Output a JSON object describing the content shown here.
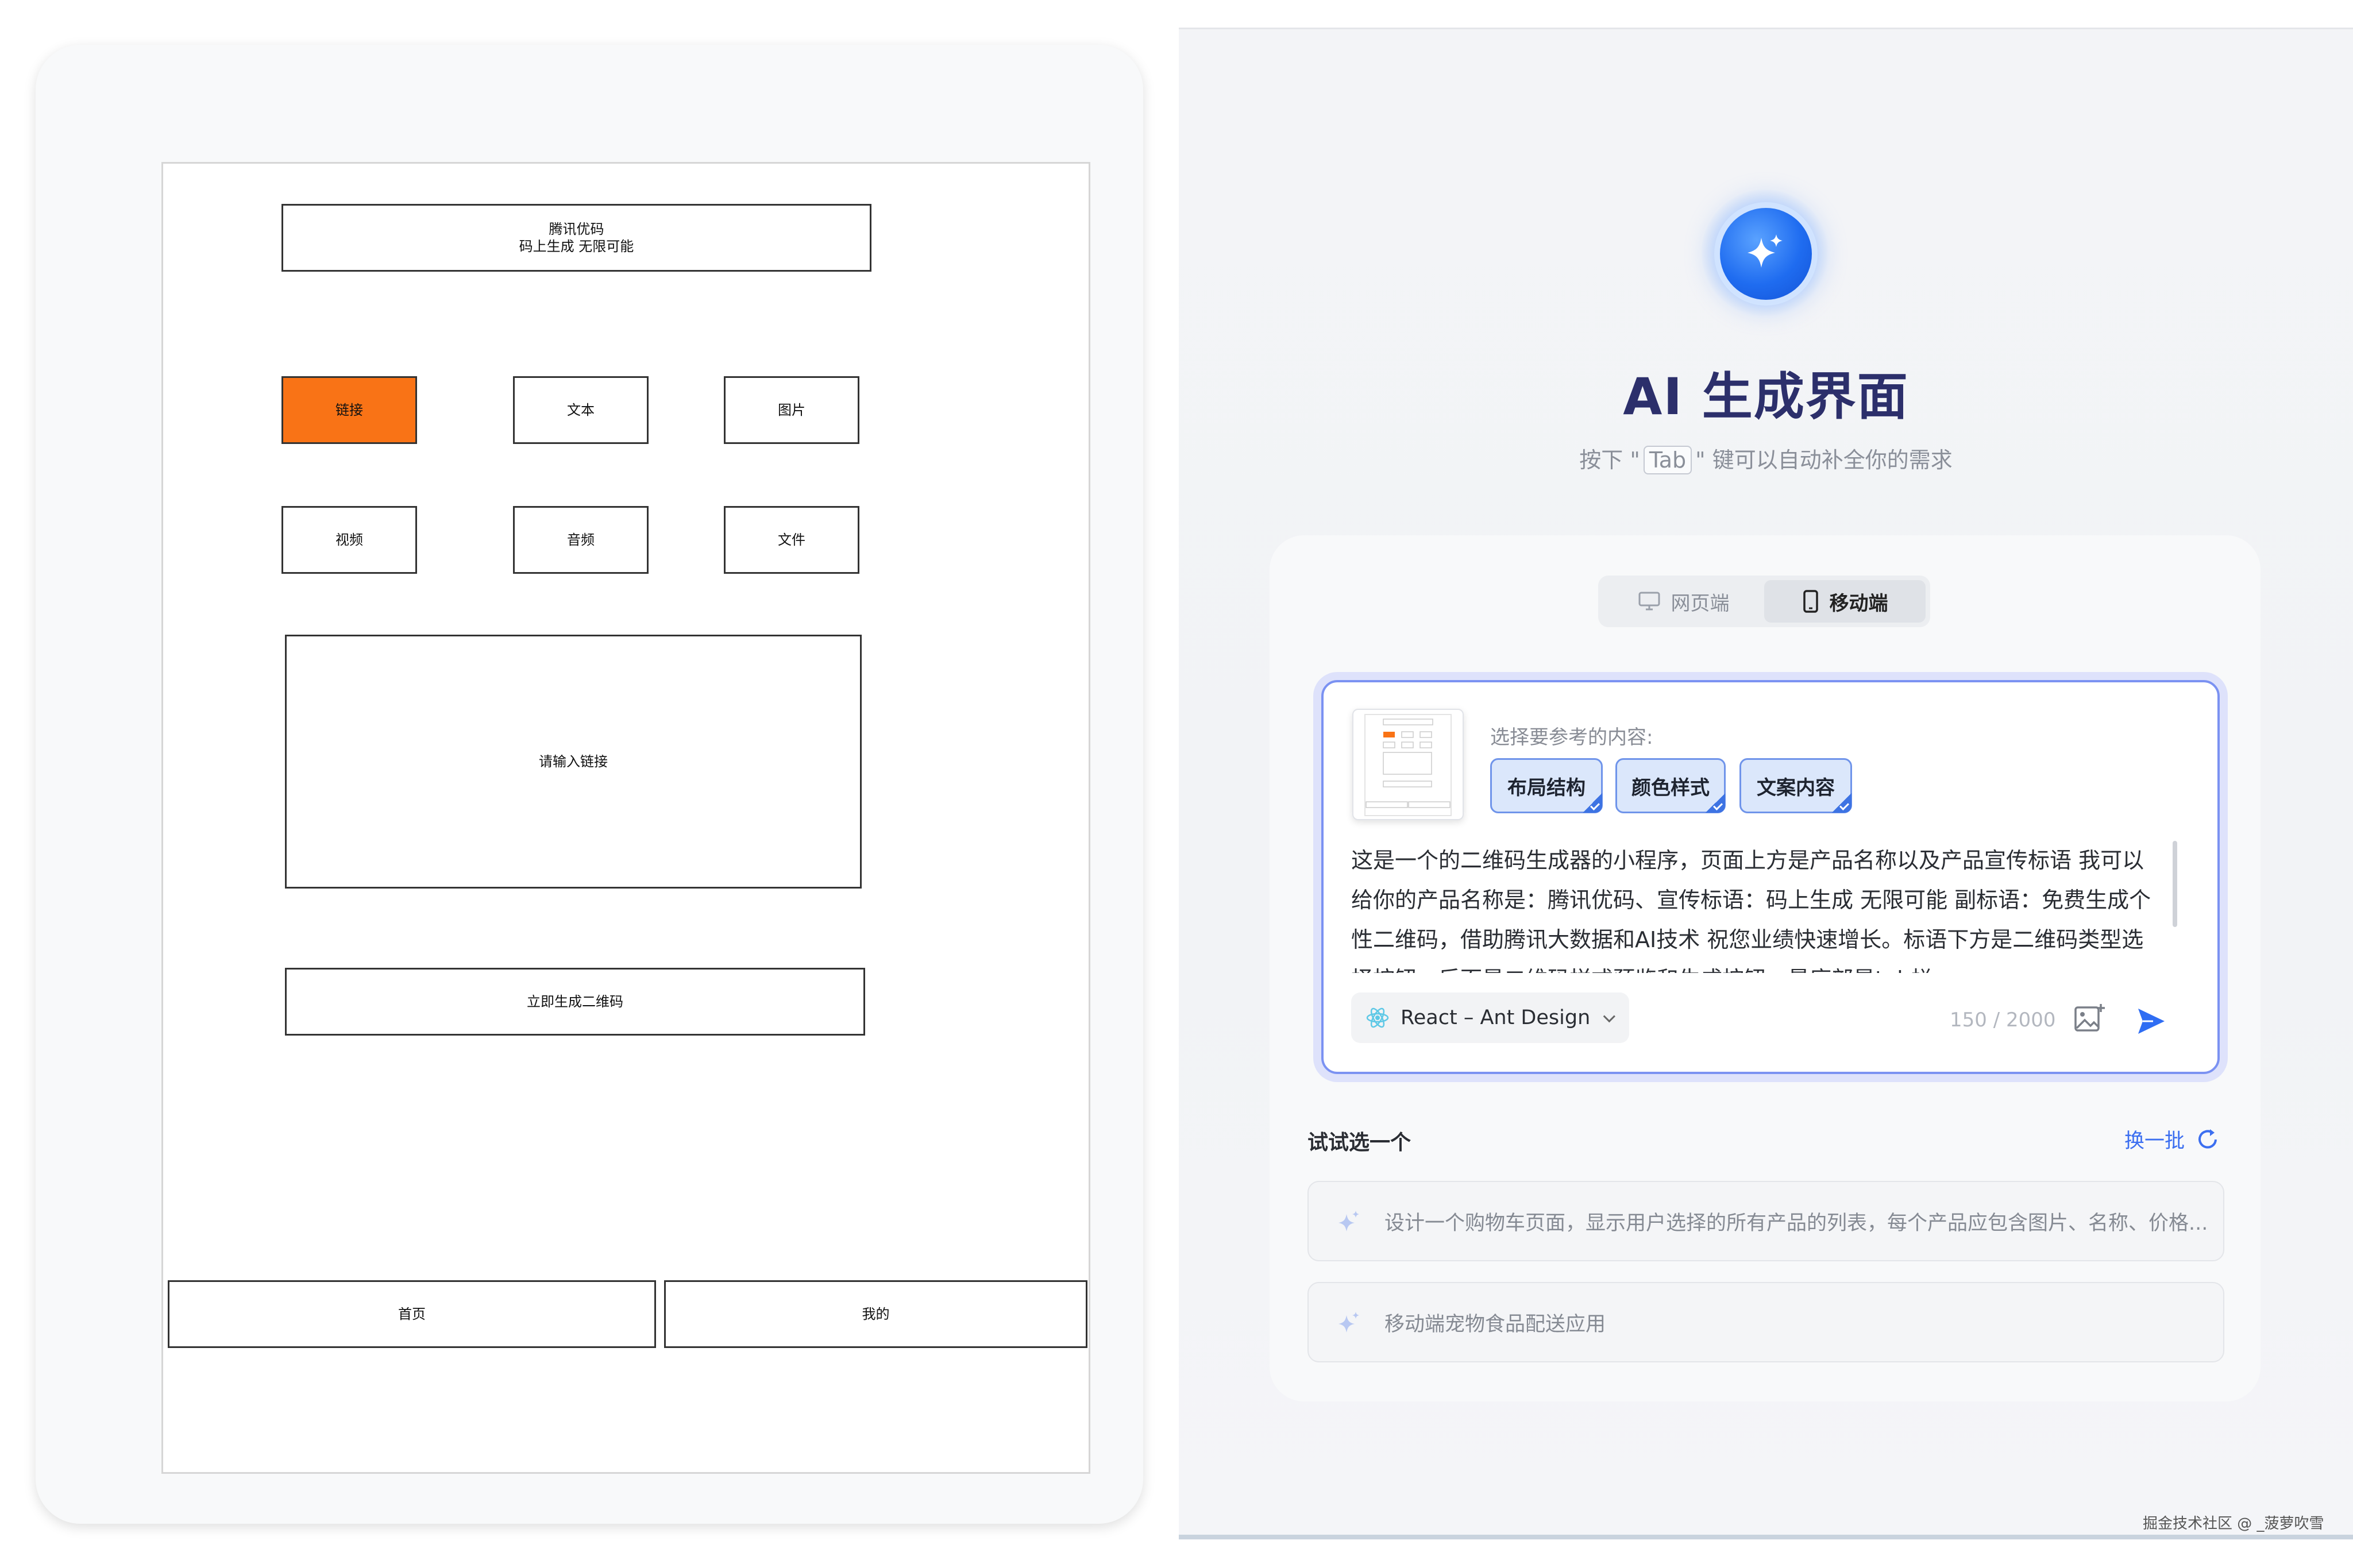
{
  "wireframe": {
    "header_line1": "腾讯优码",
    "header_line2": "码上生成 无限可能",
    "grid": [
      "链接",
      "文本",
      "图片",
      "视频",
      "音频",
      "文件"
    ],
    "input_placeholder": "请输入链接",
    "generate_button": "立即生成二维码",
    "tabs": [
      "首页",
      "我的"
    ],
    "highlight_color": "#f97316"
  },
  "panel": {
    "title": "AI 生成界面",
    "subtitle_pre": "按下 \"",
    "subtitle_key": "Tab",
    "subtitle_post": "\" 键可以自动补全你的需求",
    "device_options": [
      {
        "label": "网页端",
        "icon": "monitor-icon",
        "active": false
      },
      {
        "label": "移动端",
        "icon": "mobile-phone-icon",
        "active": true
      }
    ],
    "reference_label": "选择要参考的内容:",
    "reference_chips": [
      "布局结构",
      "颜色样式",
      "文案内容"
    ],
    "prompt_text": "这是一个的二维码生成器的小程序，页面上方是产品名称以及产品宣传标语 我可以给你的产品名称是：腾讯优码、宣传标语：码上生成 无限可能 副标语：免费生成个性二维码，借助腾讯大数据和AI技术 祝您业绩快速增长。标语下方是二维码类型选择按钮，后面是二维码样式预览和生成按钮，最底部是tab栏",
    "framework": "React – Ant Design",
    "char_count": "150 / 2000",
    "try_label": "试试选一个",
    "refresh_label": "换一批",
    "suggestions": [
      "设计一个购物车页面，显示用户选择的所有产品的列表，每个产品应包含图片、名称、价格...",
      "移动端宠物食品配送应用"
    ],
    "accent_color": "#3c6ff0"
  },
  "watermark": "掘金技术社区 @ _菠萝吹雪"
}
